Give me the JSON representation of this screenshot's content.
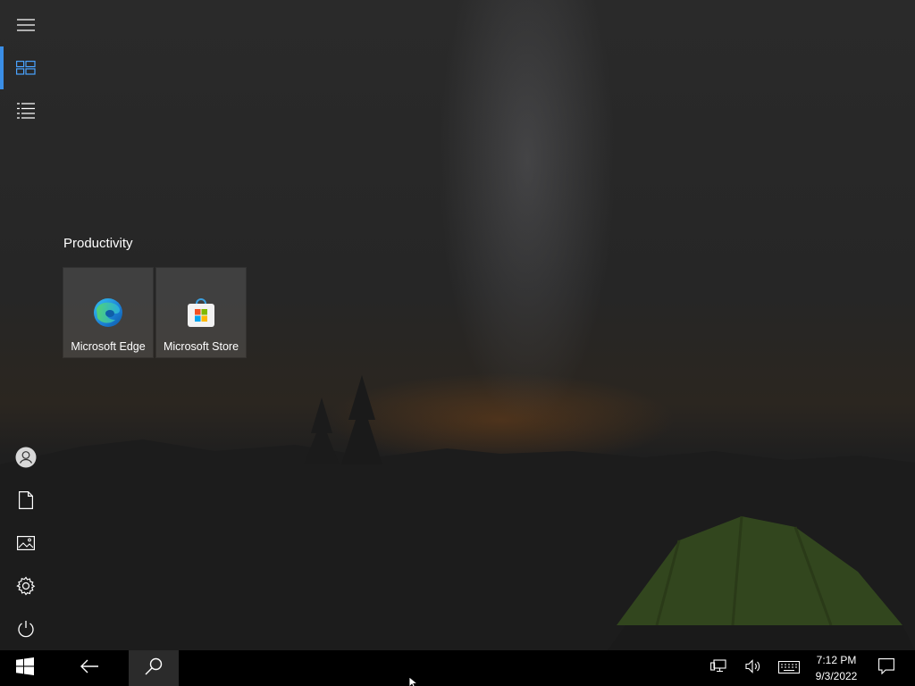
{
  "start": {
    "rail": {
      "items": [
        {
          "icon": "hamburger-menu-icon"
        },
        {
          "icon": "pinned-tiles-icon",
          "active": true
        },
        {
          "icon": "all-apps-list-icon"
        }
      ],
      "bottom_items": [
        {
          "icon": "user-account-icon"
        },
        {
          "icon": "documents-icon"
        },
        {
          "icon": "pictures-icon"
        },
        {
          "icon": "settings-gear-icon"
        },
        {
          "icon": "power-icon"
        }
      ]
    },
    "group": {
      "title": "Productivity",
      "tiles": [
        {
          "label": "Microsoft Edge",
          "icon": "microsoft-edge-icon"
        },
        {
          "label": "Microsoft Store",
          "icon": "microsoft-store-icon"
        }
      ]
    }
  },
  "taskbar": {
    "buttons": [
      {
        "icon": "windows-start-icon"
      },
      {
        "icon": "back-arrow-icon"
      },
      {
        "icon": "search-icon"
      }
    ],
    "tray": {
      "icons": [
        "network-icon",
        "volume-icon",
        "touch-keyboard-icon",
        "action-center-icon"
      ],
      "time": "7:12 PM",
      "date": "9/3/2022"
    }
  },
  "colors": {
    "accent": "#3a8ee6",
    "taskbar": "#000000",
    "tile": "#3c3c3c"
  }
}
